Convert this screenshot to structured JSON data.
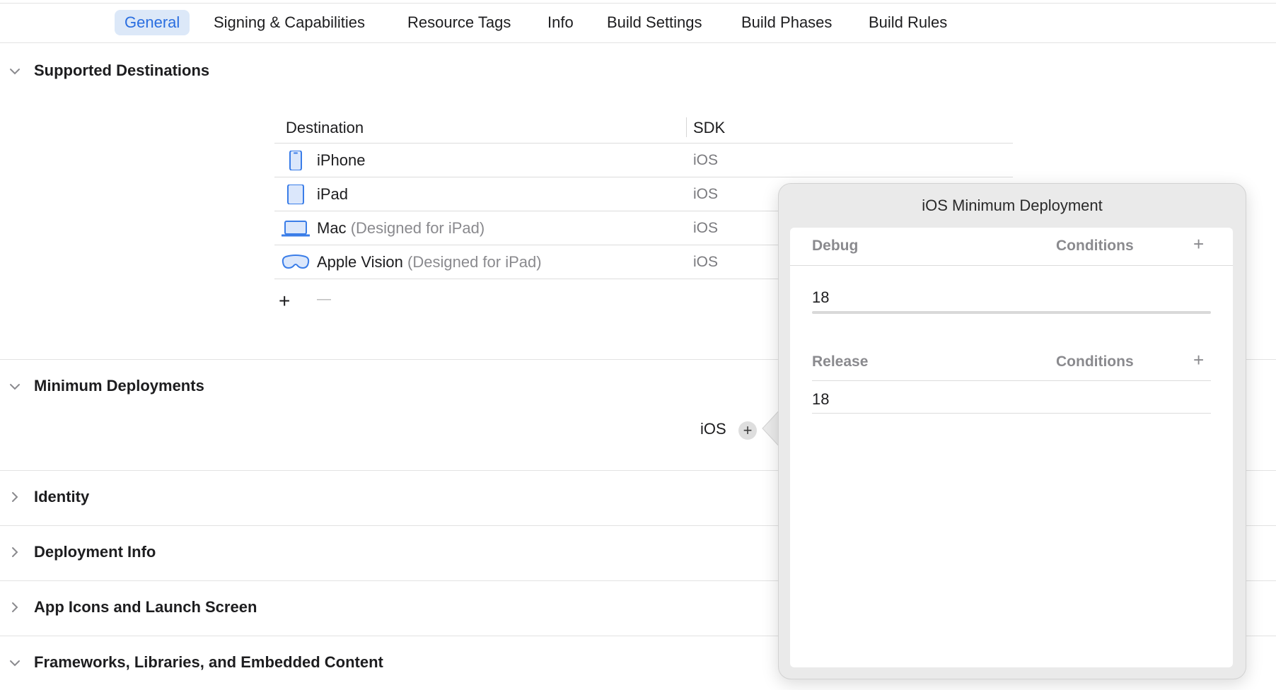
{
  "tabs": [
    {
      "label": "General",
      "active": true
    },
    {
      "label": "Signing & Capabilities"
    },
    {
      "label": "Resource Tags"
    },
    {
      "label": "Info"
    },
    {
      "label": "Build Settings"
    },
    {
      "label": "Build Phases"
    },
    {
      "label": "Build Rules"
    }
  ],
  "sections": {
    "supported_destinations": "Supported Destinations",
    "minimum_deployments": "Minimum Deployments",
    "identity": "Identity",
    "deployment_info": "Deployment Info",
    "app_icons": "App Icons and Launch Screen",
    "frameworks": "Frameworks, Libraries, and Embedded Content"
  },
  "destinations": {
    "columns": [
      "Destination",
      "SDK"
    ],
    "rows": [
      {
        "name": "iPhone",
        "suffix": "",
        "sdk": "iOS",
        "icon": "iphone-icon"
      },
      {
        "name": "iPad",
        "suffix": "",
        "sdk": "iOS",
        "icon": "ipad-icon"
      },
      {
        "name": "Mac",
        "suffix": "(Designed for iPad)",
        "sdk": "iOS",
        "icon": "laptop-icon"
      },
      {
        "name": "Apple Vision",
        "suffix": "(Designed for iPad)",
        "sdk": "iOS",
        "icon": "vision-pro-icon"
      }
    ],
    "add_symbol": "+",
    "remove_symbol": "—"
  },
  "min_deployments": {
    "platform": "iOS",
    "plus": "+"
  },
  "popover": {
    "title": "iOS Minimum Deployment",
    "debug": {
      "label": "Debug",
      "conditions": "Conditions",
      "plus": "+",
      "value": "18"
    },
    "release": {
      "label": "Release",
      "conditions": "Conditions",
      "plus": "+",
      "value": "18"
    }
  },
  "colors": {
    "accent": "#2a6ee0",
    "active_tab_bg": "#dce8f8",
    "icon_blue": "#3a7de8"
  }
}
